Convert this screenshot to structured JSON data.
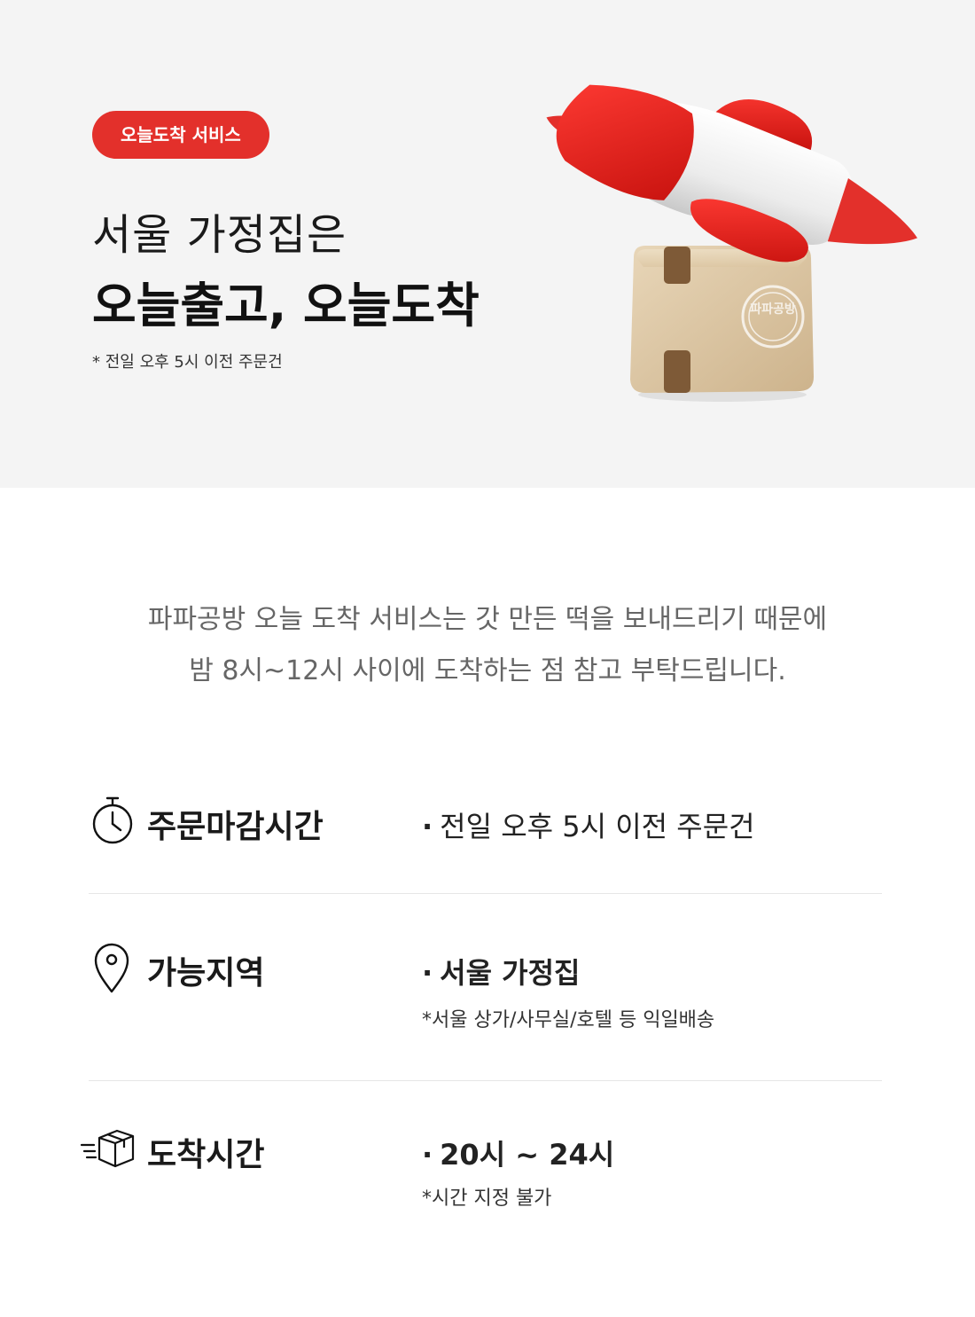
{
  "hero": {
    "badge": "오늘도착 서비스",
    "line1": "서울 가정집은",
    "line2": "오늘출고, 오늘도착",
    "note": "* 전일 오후 5시 이전 주문건",
    "illustration_icon": "rocket-on-box-icon",
    "box_stamp_text": "파파공방"
  },
  "intro": {
    "line1": "파파공방 오늘 도착 서비스는 갓 만든 떡을 보내드리기 때문에",
    "line2": "밤 8시~12시 사이에 도착하는 점 참고 부탁드립니다."
  },
  "info": [
    {
      "icon": "stopwatch-icon",
      "label": "주문마감시간",
      "bullet": "·",
      "value": "전일 오후 5시 이전 주문건"
    },
    {
      "icon": "location-pin-icon",
      "label": "가능지역",
      "bullet": "·",
      "value": "서울 가정집",
      "sub": "*서울 상가/사무실/호텔 등 익일배송"
    },
    {
      "icon": "delivery-box-icon",
      "label": "도착시간",
      "bullet": "·",
      "value": "20시 ~ 24시",
      "sub": "*시간 지정 불가"
    }
  ],
  "colors": {
    "accent": "#e3302b",
    "hero_bg": "#f4f4f4",
    "intro_text": "#666666",
    "divider": "#e6e6e6",
    "box": "#d9c3a1"
  }
}
